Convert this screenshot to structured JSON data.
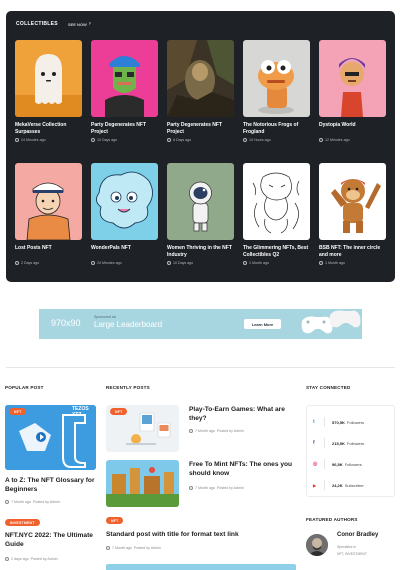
{
  "collectibles": {
    "title": "COLLECTIBLES",
    "see_now": "SEE NOW",
    "items": [
      {
        "title": "MekaVerse Collection Surpasses",
        "time": "24 Minutes ago",
        "art": "ghost"
      },
      {
        "title": "Party Degenerates NFT Project",
        "time": "10 Days ago",
        "art": "ape"
      },
      {
        "title": "Party Degenerates NFT Project",
        "time": "8 Days ago",
        "art": "painting"
      },
      {
        "title": "The Notorious Frogs of Frogland",
        "time": "10 Hours ago",
        "art": "frog"
      },
      {
        "title": "Dystopia World",
        "time": "12 Minutes ago",
        "art": "punk"
      },
      {
        "title": "Lost Posts NFT",
        "time": "2 Days ago",
        "art": "captain"
      },
      {
        "title": "WonderPals NFT",
        "time": "24 Minutes ago",
        "art": "wonderpal"
      },
      {
        "title": "Women Thriving in the NFT Industry",
        "time": "10 Days ago",
        "art": "astronaut"
      },
      {
        "title": "The Glimmering NFTs, Best Collectibles Q2",
        "time": "1 Month ago",
        "art": "sketch"
      },
      {
        "title": "BSB NFT: The inner circle and more",
        "time": "1 Month ago",
        "art": "monkey"
      }
    ]
  },
  "ad": {
    "size_label": "970x90",
    "small_text": "Sponsored ad",
    "headline": "Large Leaderboard",
    "button": "Learn More"
  },
  "popular": {
    "heading": "POPULAR POST",
    "post1": {
      "badge": "NFT",
      "title": "A to Z: The NFT Glossary for Beginners",
      "meta": "7 Month ago",
      "by": "Posted by Admin",
      "brand": "TEZOS XTZ"
    },
    "post2": {
      "badge": "INVESTMENT",
      "title": "NFT.NYC 2022: The Ultimate Guide",
      "meta": "2 days ago",
      "by": "Posted by Admin"
    }
  },
  "recent": {
    "heading": "RECENTLY POSTS",
    "posts": [
      {
        "badge": "NFT",
        "title": "Play-To-Earn Games: What are they?",
        "meta": "7 Month ago",
        "by": "Posted by Admin"
      },
      {
        "title": "Free To Mint NFTs: The ones you should know",
        "meta": "7 Month ago",
        "by": "Posted by Admin"
      },
      {
        "badge": "NFT",
        "title": "Standard post with title for format text link",
        "meta": "7 Month ago",
        "by": "Posted by Admin"
      }
    ]
  },
  "social": {
    "heading": "STAY CONNECTED",
    "rows": [
      {
        "icon": "twitter-icon",
        "glyph": "t",
        "color": "#1da1f2",
        "count": "570,5K",
        "label": "Followers"
      },
      {
        "icon": "facebook-icon",
        "glyph": "f",
        "color": "#3b5998",
        "count": "215,5K",
        "label": "Followers"
      },
      {
        "icon": "instagram-icon",
        "glyph": "◎",
        "color": "#e1306c",
        "count": "96,5K",
        "label": "Followers"
      },
      {
        "icon": "youtube-icon",
        "glyph": "▶",
        "color": "#e52d27",
        "count": "24,2K",
        "label": "Subscriber"
      }
    ]
  },
  "authors": {
    "heading": "FEATURED AUTHORS",
    "name": "Conor Bradley",
    "line1": "Specialize in",
    "line2": "NFT, INVESTMENT"
  },
  "colors": {
    "panel": "#1e2126",
    "accent": "#f0612d",
    "ad_bg": "#a8d6e0"
  }
}
